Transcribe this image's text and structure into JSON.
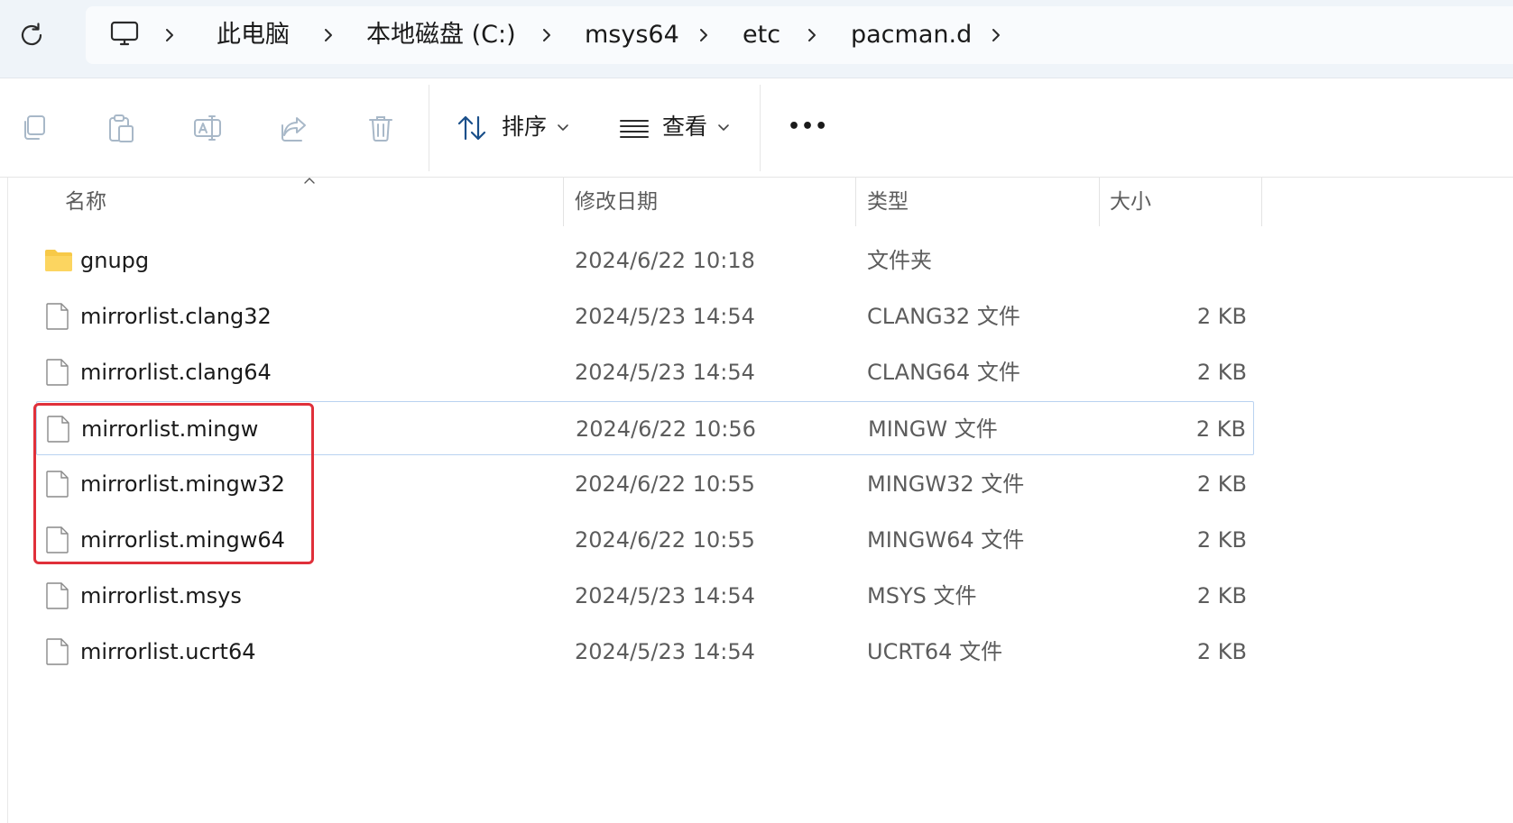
{
  "address_bar": {
    "breadcrumbs": [
      "此电脑",
      "本地磁盘 (C:)",
      "msys64",
      "etc",
      "pacman.d"
    ]
  },
  "command_bar": {
    "sort_label": "排序",
    "view_label": "查看",
    "more_label": "•••"
  },
  "file_list": {
    "columns": [
      "名称",
      "修改日期",
      "类型",
      "大小"
    ],
    "rows": [
      {
        "name": "gnupg",
        "date": "2024/6/22 10:18",
        "type": "文件夹",
        "size": "",
        "kind": "folder"
      },
      {
        "name": "mirrorlist.clang32",
        "date": "2024/5/23 14:54",
        "type": "CLANG32 文件",
        "size": "2 KB",
        "kind": "file"
      },
      {
        "name": "mirrorlist.clang64",
        "date": "2024/5/23 14:54",
        "type": "CLANG64 文件",
        "size": "2 KB",
        "kind": "file"
      },
      {
        "name": "mirrorlist.mingw",
        "date": "2024/6/22 10:56",
        "type": "MINGW 文件",
        "size": "2 KB",
        "kind": "file"
      },
      {
        "name": "mirrorlist.mingw32",
        "date": "2024/6/22 10:55",
        "type": "MINGW32 文件",
        "size": "2 KB",
        "kind": "file"
      },
      {
        "name": "mirrorlist.mingw64",
        "date": "2024/6/22 10:55",
        "type": "MINGW64 文件",
        "size": "2 KB",
        "kind": "file"
      },
      {
        "name": "mirrorlist.msys",
        "date": "2024/5/23 14:54",
        "type": "MSYS 文件",
        "size": "2 KB",
        "kind": "file"
      },
      {
        "name": "mirrorlist.ucrt64",
        "date": "2024/5/23 14:54",
        "type": "UCRT64 文件",
        "size": "2 KB",
        "kind": "file"
      }
    ]
  },
  "colors": {
    "highlight_box": "#e0303a",
    "selection_border": "#b9d2f0",
    "folder_yellow": "#f7c948"
  }
}
